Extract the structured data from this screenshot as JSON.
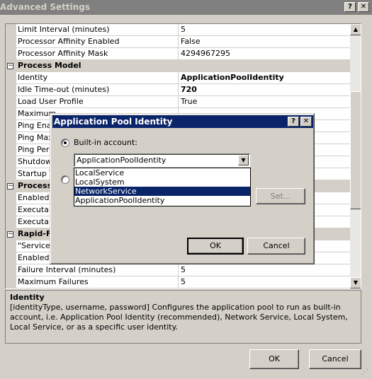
{
  "window": {
    "title": "Advanced Settings",
    "help": "?",
    "close": "✕"
  },
  "grid": {
    "rows": [
      {
        "label": "Limit Interval (minutes)",
        "value": "5"
      },
      {
        "label": "Processor Affinity Enabled",
        "value": "False"
      },
      {
        "label": "Processor Affinity Mask",
        "value": "4294967295"
      },
      {
        "label": "Process Model",
        "header": true
      },
      {
        "label": "Identity",
        "value": "ApplicationPoolIdentity",
        "bold": true
      },
      {
        "label": "Idle Time-out (minutes)",
        "value": "720",
        "bold": true
      },
      {
        "label": "Load User Profile",
        "value": "True"
      },
      {
        "label": "Maximum",
        "value": ""
      },
      {
        "label": "Ping Enab",
        "value": ""
      },
      {
        "label": "Ping Maxi",
        "value": ""
      },
      {
        "label": "Ping Peric",
        "value": ""
      },
      {
        "label": "Shutdown",
        "value": ""
      },
      {
        "label": "Startup T",
        "value": ""
      },
      {
        "label": "Process",
        "header": true
      },
      {
        "label": "Enabled",
        "value": ""
      },
      {
        "label": "Executab",
        "value": ""
      },
      {
        "label": "Executab",
        "value": ""
      },
      {
        "label": "Rapid-Fa",
        "header": true
      },
      {
        "label": "\"Service U",
        "value": ""
      },
      {
        "label": "Enabled",
        "value": ""
      },
      {
        "label": "Failure Interval (minutes)",
        "value": "5"
      },
      {
        "label": "Maximum Failures",
        "value": "5"
      }
    ]
  },
  "description": {
    "title": "Identity",
    "text": "[identityType, username, password] Configures the application pool to run as built-in account, i.e. Application Pool Identity (recommended), Network Service, Local System, Local Service, or as a specific user identity."
  },
  "buttons": {
    "ok": "OK",
    "cancel": "Cancel"
  },
  "dialog": {
    "title": "Application Pool Identity",
    "help": "?",
    "close": "✕",
    "builtin_label": "Built-in account:",
    "selected": "ApplicationPoolIdentity",
    "options": [
      "LocalService",
      "LocalSystem",
      "NetworkService",
      "ApplicationPoolIdentity"
    ],
    "highlighted_index": 2,
    "set_label": "Set...",
    "ok": "OK",
    "cancel": "Cancel"
  },
  "colors": {
    "title_active": "#0a246a",
    "title_inactive": "#808080",
    "face": "#d4d0c8"
  }
}
